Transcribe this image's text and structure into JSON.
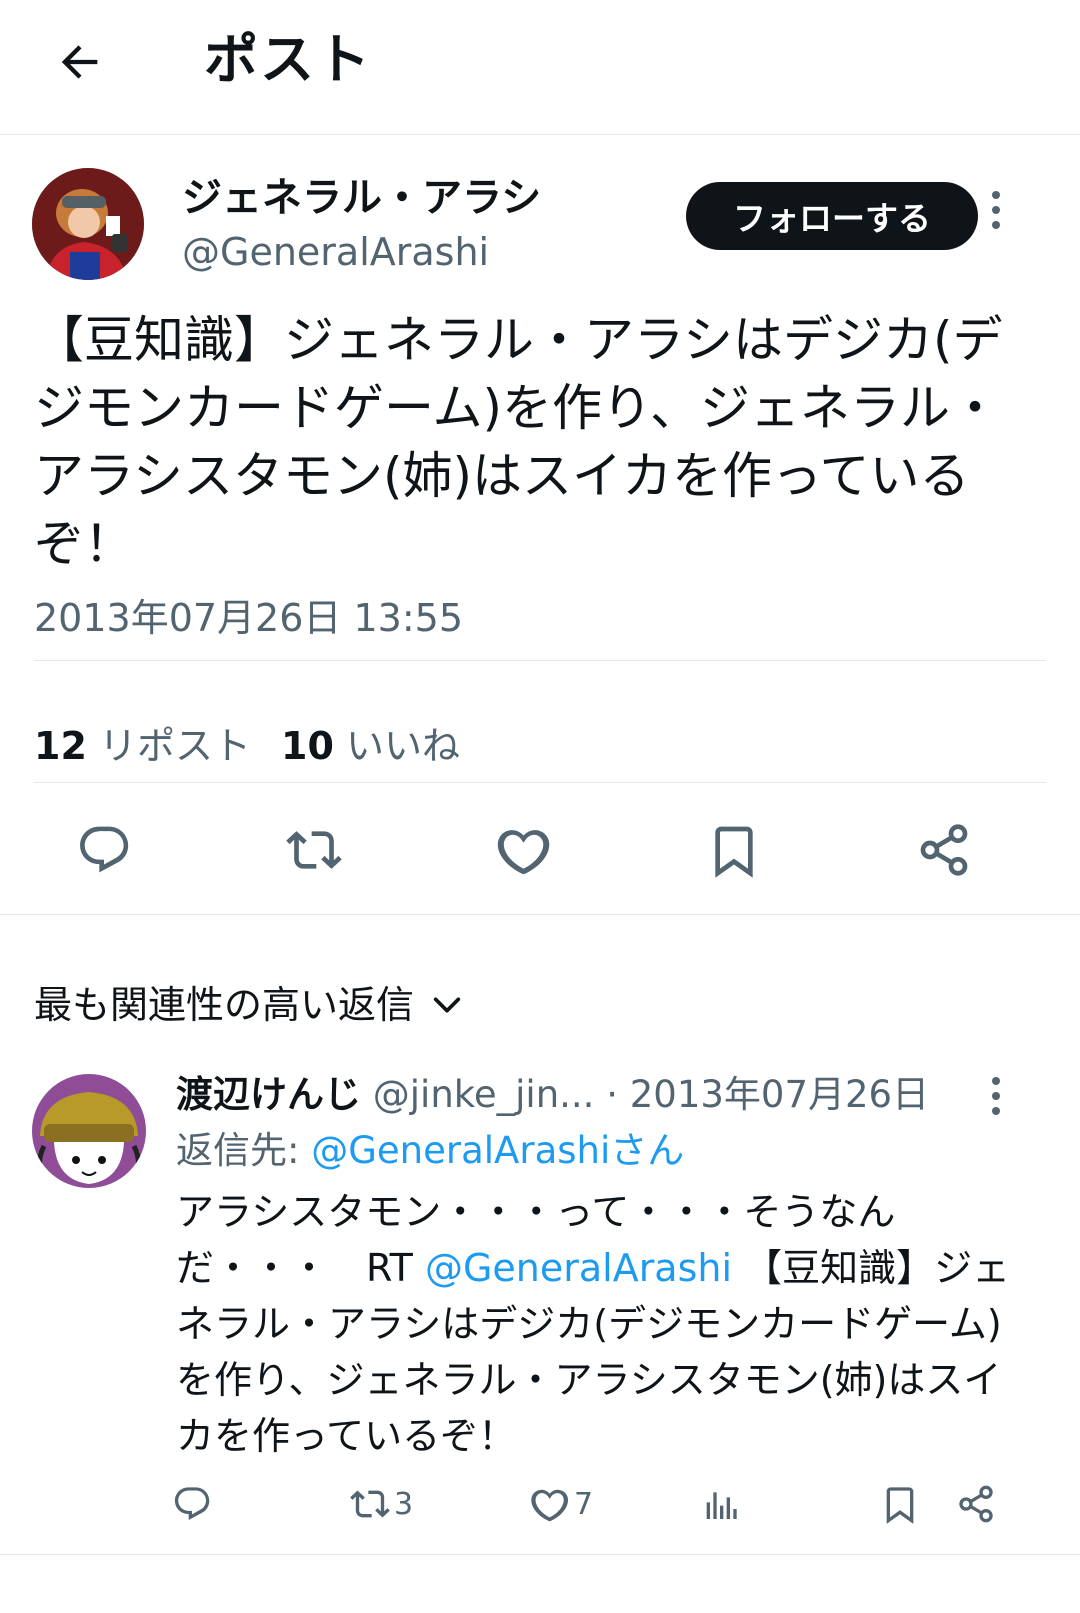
{
  "header": {
    "title": "ポスト",
    "back_icon": "arrow-left-icon"
  },
  "tweet": {
    "author": {
      "name": "ジェネラル・アラシ",
      "handle": "@GeneralArashi"
    },
    "follow_label": "フォローする",
    "text": "【豆知識】ジェネラル・アラシはデジカ(デジモンカードゲーム)を作り、ジェネラル・アラシスタモン(姉)はスイカを作っているぞ！",
    "timestamp": "2013年07月26日 13:55",
    "stats": {
      "reposts_count": "12",
      "reposts_label": "リポスト",
      "likes_count": "10",
      "likes_label": "いいね"
    },
    "actions": [
      "reply-icon",
      "repost-icon",
      "like-icon",
      "bookmark-icon",
      "share-icon"
    ]
  },
  "replies_sort": {
    "label": "最も関連性の高い返信"
  },
  "reply": {
    "name": "渡辺けんじ",
    "handle": "@jinke_jin...",
    "date": "· 2013年07月26日",
    "reply_to_prefix": "返信先: ",
    "reply_to_handle": "@GeneralArashiさん",
    "text_part1": "アラシスタモン・・・って・・・そうなんだ・・・　RT ",
    "text_mention": "@GeneralArashi",
    "text_part2": " 【豆知識】ジェネラル・アラシはデジカ(デジモンカードゲーム)を作り、ジェネラル・アラシスタモン(姉)はスイカを作っているぞ！",
    "retweets": "3",
    "likes": "7"
  },
  "colors": {
    "text": "#0f1419",
    "muted": "#536471",
    "link": "#1d9bf0",
    "border": "#e7e9ea",
    "button": "#0f1419"
  }
}
